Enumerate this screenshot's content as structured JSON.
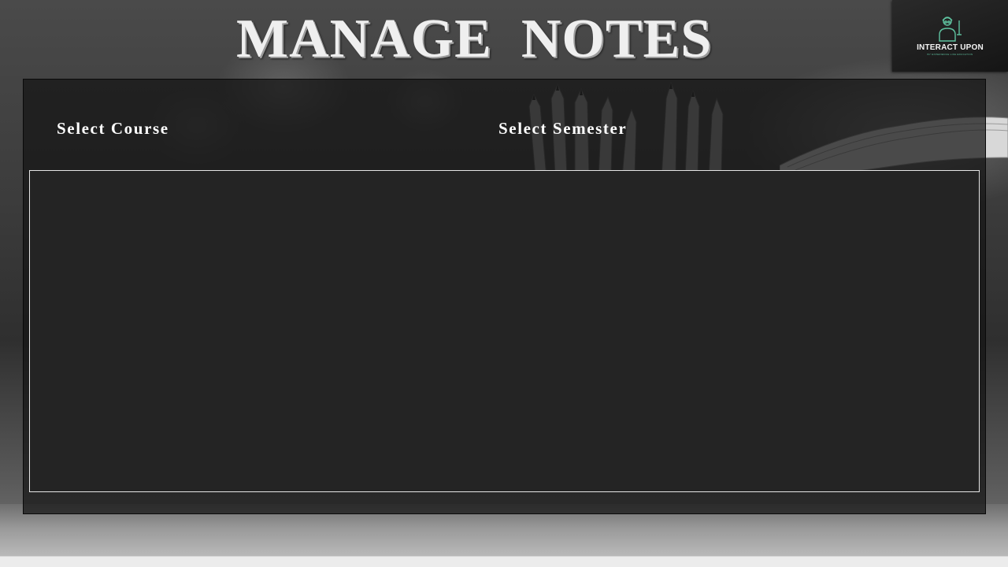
{
  "page": {
    "title": "MANAGE  NOTES"
  },
  "logo": {
    "name": "INTERACT UPON",
    "tagline": "BY EXPERIENCE LIFE EDUCATION",
    "icon": "teacher-icon",
    "accent": "#5fc3a0"
  },
  "filters": {
    "course_label": "Select Course",
    "semester_label": "Select Semester"
  },
  "notes_area": {
    "background": "#242424",
    "border": "#e6e6e6"
  }
}
